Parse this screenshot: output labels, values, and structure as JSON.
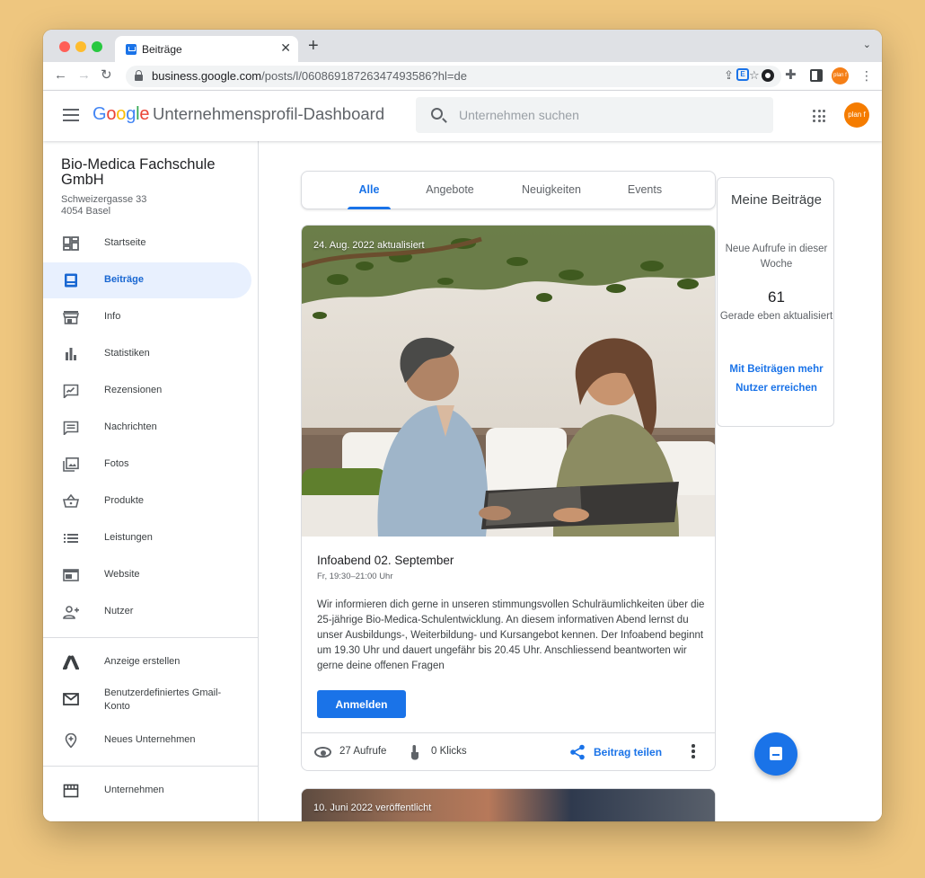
{
  "browser": {
    "tab_title": "Beiträge",
    "url_domain": "business.google.com",
    "url_path": "/posts/l/06086918726347493586?hl=de",
    "profile_badge": "plan f"
  },
  "header": {
    "logo_letters": [
      "G",
      "o",
      "o",
      "g",
      "l",
      "e"
    ],
    "title": "Unternehmensprofil-Dashboard",
    "search_placeholder": "Unternehmen suchen",
    "avatar_text": "plan f"
  },
  "business": {
    "name": "Bio-Medica Fachschule GmbH",
    "street": "Schweizergasse 33",
    "city": "4054 Basel"
  },
  "sidebar": {
    "items": [
      {
        "label": "Startseite",
        "icon": "dashboard-icon"
      },
      {
        "label": "Beiträge",
        "icon": "posts-icon",
        "active": true
      },
      {
        "label": "Info",
        "icon": "storefront-icon"
      },
      {
        "label": "Statistiken",
        "icon": "bar-chart-icon"
      },
      {
        "label": "Rezensionen",
        "icon": "reviews-icon"
      },
      {
        "label": "Nachrichten",
        "icon": "message-icon"
      },
      {
        "label": "Fotos",
        "icon": "photos-icon"
      },
      {
        "label": "Produkte",
        "icon": "basket-icon"
      },
      {
        "label": "Leistungen",
        "icon": "list-icon"
      },
      {
        "label": "Website",
        "icon": "website-icon"
      },
      {
        "label": "Nutzer",
        "icon": "add-user-icon"
      }
    ],
    "extra_items": [
      {
        "label": "Anzeige erstellen",
        "icon": "google-ads-icon"
      },
      {
        "label": "Benutzerdefiniertes Gmail-Konto",
        "icon": "gmail-icon"
      },
      {
        "label": "Neues Unternehmen",
        "icon": "add-location-icon"
      }
    ],
    "bottom_items": [
      {
        "label": "Unternehmen",
        "icon": "store-icon"
      }
    ]
  },
  "posts_tabs": [
    "Alle",
    "Angebote",
    "Neuigkeiten",
    "Events"
  ],
  "active_tab": "Alle",
  "post": {
    "date_overlay": "24. Aug. 2022 aktualisiert",
    "title": "Infoabend 02. September",
    "time": "Fr, 19:30–21:00 Uhr",
    "body": "Wir informieren dich gerne in unseren stimmungsvollen Schulräumlichkeiten über die 25-jährige Bio-Medica-Schulentwicklung. An diesem informativen Abend lernst du unser Ausbildungs-, Weiterbildung- und Kursangebot kennen. Der Infoabend beginnt um 19.30 Uhr und dauert ungefähr bis 20.45 Uhr. Anschliessend beantworten wir gerne deine offenen Fragen",
    "cta_label": "Anmelden",
    "views": "27 Aufrufe",
    "clicks": "0 Klicks",
    "share_label": "Beitrag teilen"
  },
  "post2": {
    "date_overlay": "10. Juni 2022 veröffentlicht"
  },
  "side_card": {
    "title": "Meine Beiträge",
    "subtitle": "Neue Aufrufe in dieser Woche",
    "count": "61",
    "updated": "Gerade eben aktualisiert",
    "link": "Mit Beiträgen mehr Nutzer erreichen"
  },
  "colors": {
    "accent": "#1a73e8",
    "active_bg": "#e8f0fe",
    "avatar": "#f57c00"
  }
}
